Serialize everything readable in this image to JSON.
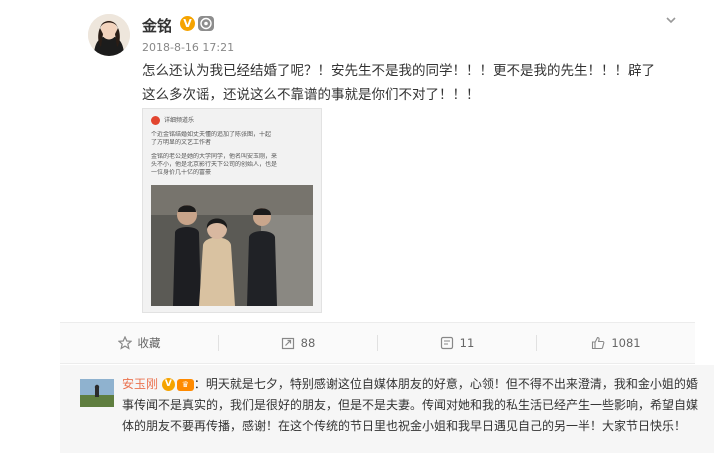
{
  "post": {
    "author": {
      "name": "金铭",
      "verified": "V"
    },
    "timestamp": "2018-8-16 17:21",
    "body": "怎么还认为我已经结婚了呢？！安先生不是我的同学！！！更不是我的先生！！！辟了这么多次谣，还说这么不靠谱的事就是你们不对了！！！",
    "embed": {
      "source": "详细频道乐",
      "lines": [
        "个近金铭结婚如丈夫懂的追加了陈张图，十起",
        "了方明显的文艺工作者",
        "金铭的老公是她的大学同学，他名叫安玉刚，来",
        "头不小，他是北京影行天下公司的创始人，也是",
        "一位身价几十亿的富豪"
      ]
    }
  },
  "actions": [
    {
      "label": "收藏",
      "icon": "star-icon"
    },
    {
      "label": "88",
      "icon": "share-icon"
    },
    {
      "label": "11",
      "icon": "comment-icon"
    },
    {
      "label": "1081",
      "icon": "thumbs-up-icon"
    }
  ],
  "comment": {
    "author": "安玉刚",
    "verified": "V",
    "separator": "：",
    "text": "明天就是七夕，特别感谢这位自媒体朋友的好意，心领！但不得不出来澄清，我和金小姐的婚事传闻不是真实的，我们是很好的朋友，但是不是夫妻。传闻对她和我的私生活已经产生一些影响，希望自媒体的朋友不要再传播，感谢！在这个传统的节日里也祝金小姐和我早日遇见自己的另一半！大家节日快乐！"
  },
  "colors": {
    "accent_orange": "#eb7350",
    "verified_badge": "#f5a300",
    "text": "#333333",
    "muted": "#888888"
  }
}
